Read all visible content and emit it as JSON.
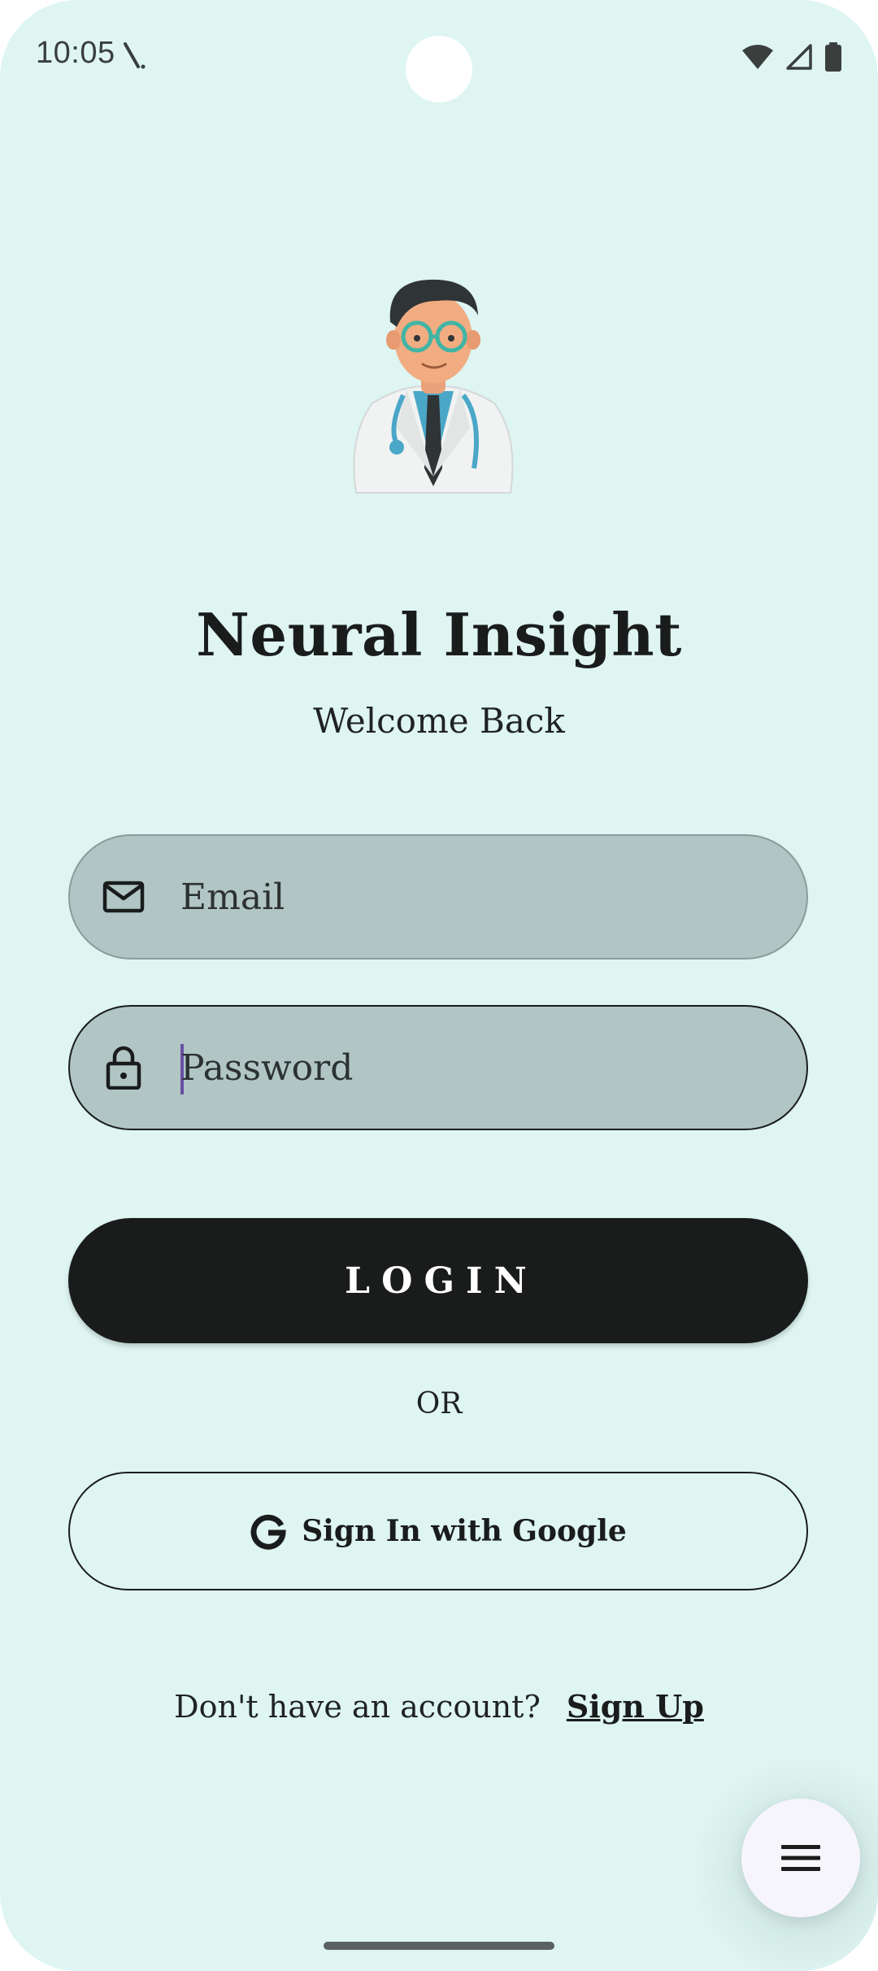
{
  "status_bar": {
    "time": "10:05",
    "icons": [
      "activity-icon",
      "wifi-icon",
      "signal-icon",
      "battery-icon"
    ]
  },
  "header": {
    "illustration": "doctor-avatar",
    "title": "Neural Insight",
    "subtitle": "Welcome Back"
  },
  "form": {
    "email": {
      "icon": "mail-icon",
      "placeholder": "Email",
      "value": ""
    },
    "password": {
      "icon": "lock-icon",
      "placeholder": "Password",
      "value": ""
    },
    "login_label": "LOGIN",
    "or_text": "OR",
    "google": {
      "icon": "google-icon",
      "label": "Sign In with Google"
    }
  },
  "footer": {
    "prompt": "Don't have an account?",
    "signup_label": "Sign Up"
  },
  "fab": {
    "icon": "menu-icon"
  },
  "colors": {
    "background": "#def5f2",
    "field_fill": "#b1c6c4",
    "primary": "#1a1c1c",
    "cursor": "#6750a4",
    "fab": "#f6f5fc"
  }
}
